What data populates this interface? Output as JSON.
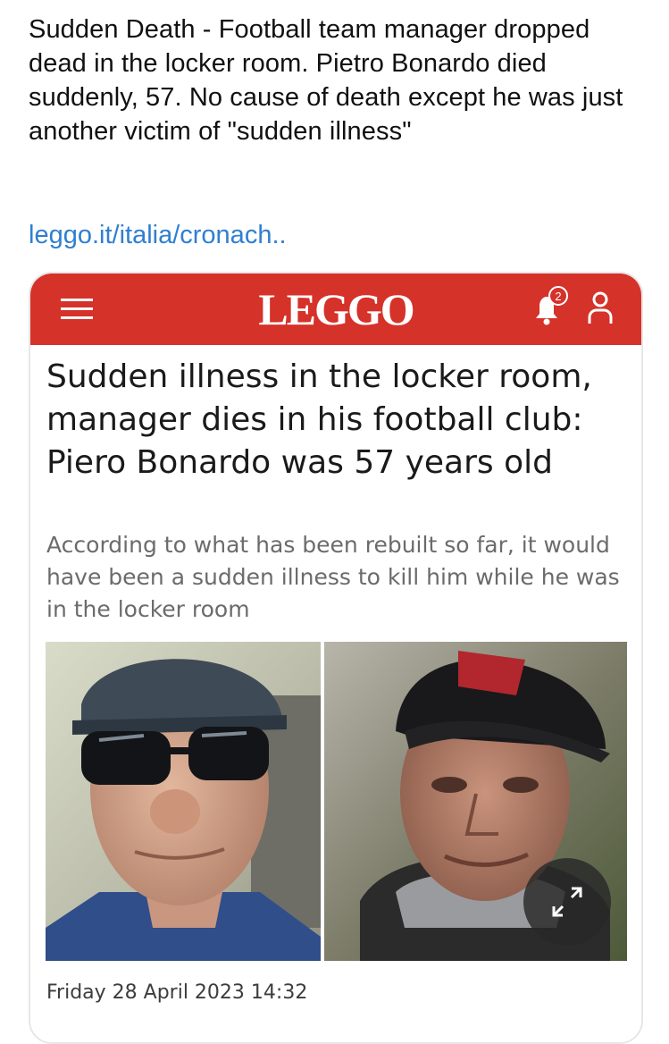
{
  "post": {
    "text": "Sudden Death - Football team manager dropped dead in the locker room. Pietro Bonardo died suddenly, 57. No cause of death except he was just another victim of \"sudden illness\"",
    "link": "leggo.it/italia/cronach.."
  },
  "card": {
    "site_name": "LEGGO",
    "notification_count": "2",
    "headline": "Sudden illness in the locker room, manager dies in his football club: Piero Bonardo was 57 years old",
    "subtitle": "According to what has been rebuilt so far, it would have been a sudden illness to kill him while he was in the locker room",
    "date": "Friday 28 April 2023 14:32",
    "colors": {
      "brand_red": "#d5322a",
      "link_blue": "#2f7fd0"
    }
  }
}
